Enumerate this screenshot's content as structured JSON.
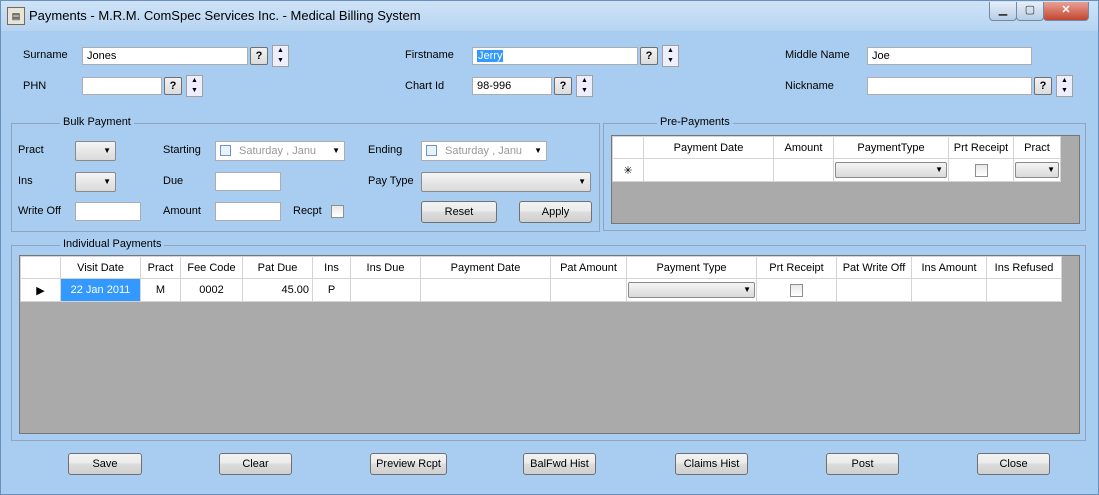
{
  "window": {
    "title": "Payments - M.R.M. ComSpec Services Inc. - Medical Billing System",
    "minimize_glyph": "▁",
    "maximize_glyph": "▢",
    "close_glyph": "✕"
  },
  "patient": {
    "surname_label": "Surname",
    "surname_value": "Jones",
    "firstname_label": "Firstname",
    "firstname_value": "Jerry",
    "middle_label": "Middle Name",
    "middle_value": "Joe",
    "phn_label": "PHN",
    "phn_value": "",
    "chart_label": "Chart Id",
    "chart_value": "98-996",
    "nickname_label": "Nickname",
    "nickname_value": "",
    "lookup_label": "?"
  },
  "bulk": {
    "title": "Bulk Payment",
    "pract_label": "Pract",
    "ins_label": "Ins",
    "writeoff_label": "Write Off",
    "starting_label": "Starting",
    "due_label": "Due",
    "amount_label": "Amount",
    "recpt_label": "Recpt",
    "ending_label": "Ending",
    "paytype_label": "Pay Type",
    "starting_date": "Saturday  ,   Janu",
    "ending_date": "Saturday  ,   Janu",
    "reset_label": "Reset",
    "apply_label": "Apply"
  },
  "prepay": {
    "title": "Pre-Payments",
    "columns": [
      "Payment Date",
      "Amount",
      "PaymentType",
      "Prt Receipt",
      "Pract"
    ],
    "new_row_marker": "✳"
  },
  "individual": {
    "title": "Individual Payments",
    "columns": [
      "Visit Date",
      "Pract",
      "Fee Code",
      "Pat Due",
      "Ins",
      "Ins Due",
      "Payment Date",
      "Pat Amount",
      "Payment Type",
      "Prt Receipt",
      "Pat Write Off",
      "Ins Amount",
      "Ins Refused"
    ],
    "row_marker": "▶",
    "rows": [
      {
        "visit_date": "22 Jan 2011",
        "pract": "M",
        "fee_code": "0002",
        "pat_due": "45.00",
        "ins": "P",
        "ins_due": "",
        "payment_date": "",
        "pat_amount": "",
        "pat_write_off": "",
        "ins_amount": "",
        "ins_refused": ""
      }
    ]
  },
  "footer": {
    "save": "Save",
    "clear": "Clear",
    "preview": "Preview Rcpt",
    "balfwd": "BalFwd Hist",
    "claims": "Claims Hist",
    "post": "Post",
    "close": "Close"
  },
  "colors": {
    "form_bg": "#a9cdf0",
    "grid_bg": "#aaaaaa",
    "selection": "#3399ff"
  }
}
